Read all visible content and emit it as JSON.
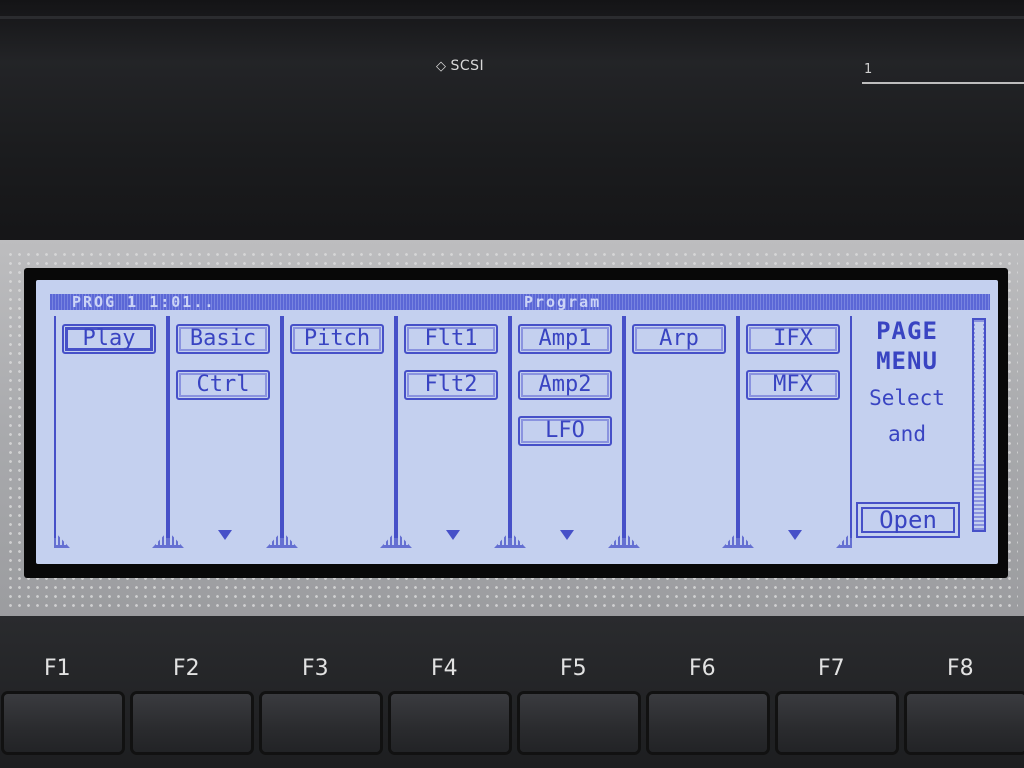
{
  "device": {
    "scsi_label": "SCSI",
    "slot_label": "1"
  },
  "lcd": {
    "header_left": "PROG 1 1:01..",
    "header_right": "Program",
    "tabs": [
      {
        "buttons": [
          "Play"
        ],
        "selected": "Play",
        "more": false
      },
      {
        "buttons": [
          "Basic",
          "Ctrl"
        ],
        "selected": "",
        "more": true
      },
      {
        "buttons": [
          "Pitch"
        ],
        "selected": "",
        "more": false
      },
      {
        "buttons": [
          "Flt1",
          "Flt2"
        ],
        "selected": "",
        "more": true
      },
      {
        "buttons": [
          "Amp1",
          "Amp2",
          "LFO"
        ],
        "selected": "",
        "more": true
      },
      {
        "buttons": [
          "Arp"
        ],
        "selected": "",
        "more": false
      },
      {
        "buttons": [
          "IFX",
          "MFX"
        ],
        "selected": "",
        "more": true
      }
    ],
    "page_menu": {
      "title_line1": "PAGE",
      "title_line2": "MENU",
      "text_line1": "Select",
      "text_line2": "and",
      "open_label": "Open"
    }
  },
  "function_keys": [
    "F1",
    "F2",
    "F3",
    "F4",
    "F5",
    "F6",
    "F7",
    "F8"
  ],
  "colors": {
    "lcd_background": "#c4d0ef",
    "lcd_ink": "#3944c2"
  }
}
